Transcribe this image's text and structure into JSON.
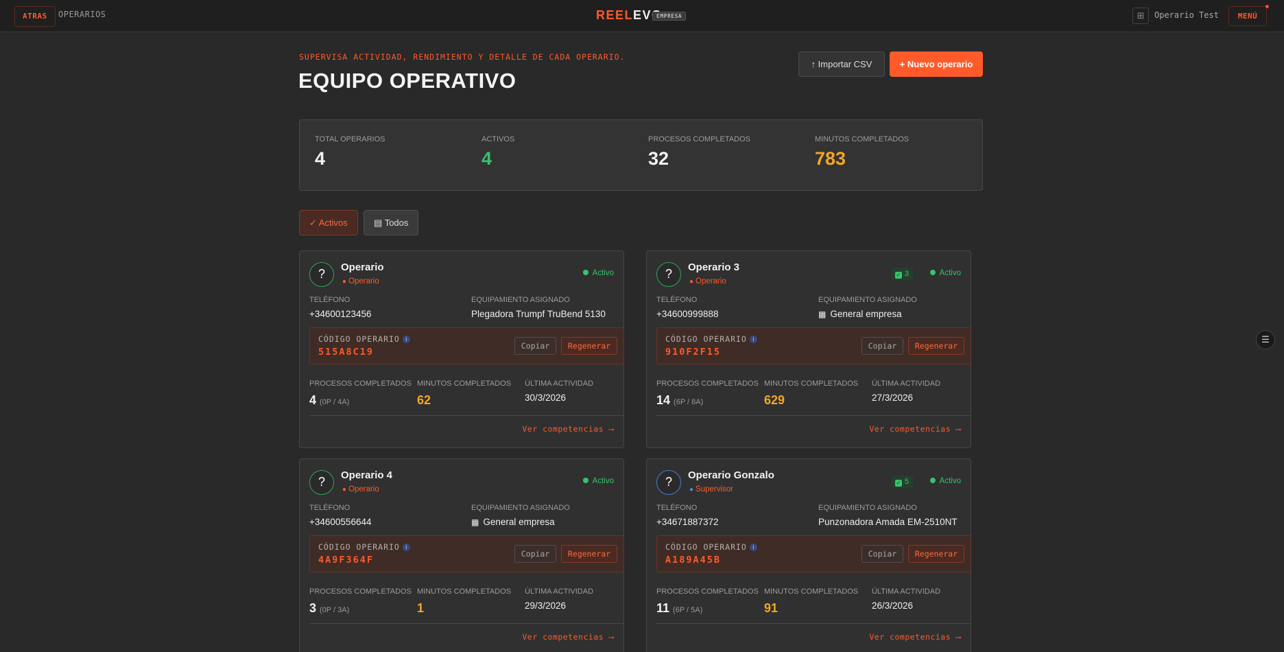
{
  "topbar": {
    "back_label": "ATRAS",
    "breadcrumb": "OPERARIOS",
    "brand_part1": "REEL",
    "brand_part2": "EVO",
    "brand_tag": "EMPRESA",
    "user_name": "Operario Test",
    "menu_label": "MENÚ"
  },
  "header": {
    "subtitle": "SUPERVISA ACTIVIDAD, RENDIMIENTO Y DETALLE DE CADA OPERARIO.",
    "title": "EQUIPO OPERATIVO",
    "import_label": "↑ Importar CSV",
    "new_label": "+ Nuevo operario"
  },
  "stats": [
    {
      "label": "TOTAL OPERARIOS",
      "value": "4",
      "color": "#f2f2f2"
    },
    {
      "label": "ACTIVOS",
      "value": "4",
      "color": "#36c46a"
    },
    {
      "label": "PROCESOS COMPLETADOS",
      "value": "32",
      "color": "#f2f2f2"
    },
    {
      "label": "MINUTOS COMPLETADOS",
      "value": "783",
      "color": "#f5a623"
    }
  ],
  "filters": {
    "active_label": "✓ Activos",
    "all_label": "Todos"
  },
  "labels": {
    "phone": "TELÉFONO",
    "equipment": "EQUIPAMIENTO ASIGNADO",
    "code": "CÓDIGO OPERARIO",
    "copy": "Copiar",
    "regen": "Regenerar",
    "processes": "PROCESOS COMPLETADOS",
    "minutes": "MINUTOS COMPLETADOS",
    "last": "ÚLTIMA ACTIVIDAD",
    "competencies": "Ver competencias ⟶",
    "status": "Activo"
  },
  "operators": [
    {
      "name": "Operario",
      "role": "Operario",
      "role_icon": "operario-icon",
      "phone": "+34600123456",
      "equipment": "Plegadora Trumpf TruBend 5130",
      "equipment_icon": "",
      "code": "515A8C19",
      "processes": "4",
      "processes_detail": "(0P / 4A)",
      "minutes": "62",
      "last_activity": "30/3/2026",
      "badge": ""
    },
    {
      "name": "Operario 3",
      "role": "Operario",
      "role_icon": "operario-icon",
      "phone": "+34600999888",
      "equipment": "General empresa",
      "equipment_icon": "building-icon",
      "code": "910F2F15",
      "processes": "14",
      "processes_detail": "(6P / 8A)",
      "minutes": "629",
      "last_activity": "27/3/2026",
      "badge": "3"
    },
    {
      "name": "Operario 4",
      "role": "Operario",
      "role_icon": "operario-icon",
      "phone": "+34600556644",
      "equipment": "General empresa",
      "equipment_icon": "building-icon",
      "code": "4A9F364F",
      "processes": "3",
      "processes_detail": "(0P / 3A)",
      "minutes": "1",
      "last_activity": "29/3/2026",
      "badge": ""
    },
    {
      "name": "Operario Gonzalo",
      "role": "Supervisor",
      "role_icon": "supervisor-icon",
      "phone": "+34671887372",
      "equipment": "Punzonadora Amada EM-2510NT",
      "equipment_icon": "",
      "code": "A189A45B",
      "processes": "11",
      "processes_detail": "(6P / 5A)",
      "minutes": "91",
      "last_activity": "26/3/2026",
      "badge": "5"
    }
  ]
}
